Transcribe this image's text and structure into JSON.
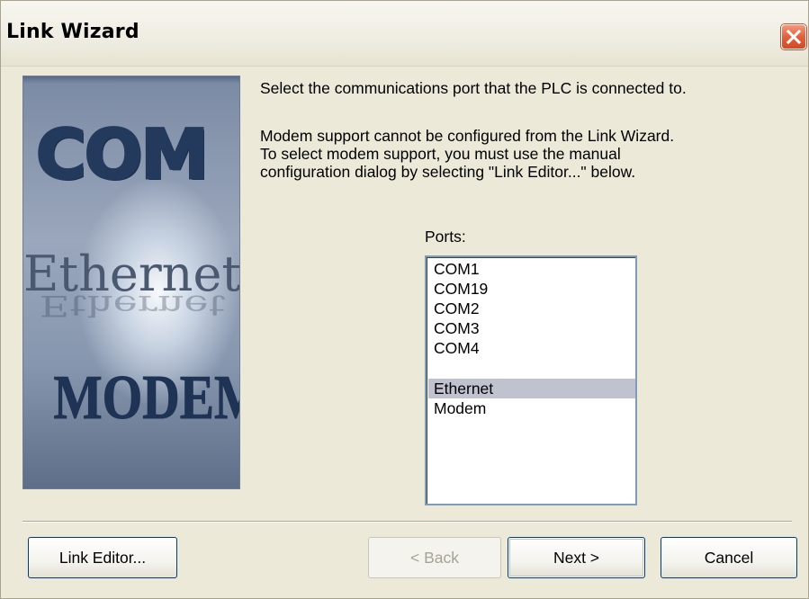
{
  "window": {
    "title": "Link Wizard"
  },
  "graphic": {
    "com": "COM",
    "ethernet": "Ethernet",
    "modem": "MODEM"
  },
  "instructions": {
    "line1": "Select the communications port that the PLC is connected to.",
    "line2": "Modem support cannot be configured from the Link Wizard.",
    "line3": "To select modem support, you must use the manual",
    "line4": "configuration dialog by selecting \"Link Editor...\" below."
  },
  "ports": {
    "label": "Ports:",
    "items": [
      "COM1",
      "COM19",
      "COM2",
      "COM3",
      "COM4",
      "Ethernet",
      "Modem"
    ],
    "selected": "Ethernet"
  },
  "buttons": {
    "link_editor": "Link Editor...",
    "back": "< Back",
    "next": "Next >",
    "cancel": "Cancel"
  },
  "colors": {
    "dialog_bg": "#ece9d8",
    "close_button": "#e2603d",
    "selection": "#c1c2cf",
    "button_border": "#003c74"
  }
}
